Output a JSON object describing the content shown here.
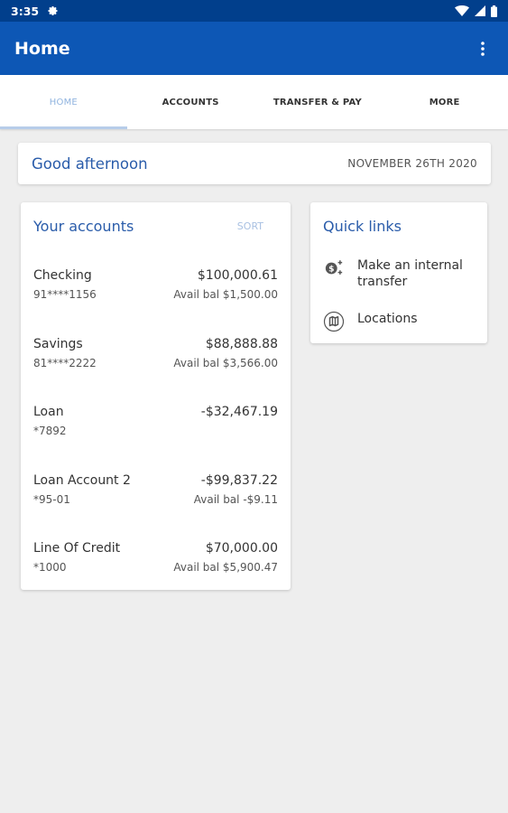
{
  "status_bar": {
    "time": "3:35"
  },
  "app_bar": {
    "title": "Home"
  },
  "tabs": [
    {
      "label": "HOME",
      "active": true
    },
    {
      "label": "ACCOUNTS",
      "active": false
    },
    {
      "label": "TRANSFER & PAY",
      "active": false
    },
    {
      "label": "MORE",
      "active": false
    }
  ],
  "greeting": {
    "text": "Good afternoon",
    "date": "NOVEMBER 26TH 2020"
  },
  "accounts": {
    "title": "Your accounts",
    "sort_label": "SORT",
    "items": [
      {
        "name": "Checking",
        "number": "91****1156",
        "balance": "$100,000.61",
        "available": "Avail bal $1,500.00"
      },
      {
        "name": "Savings",
        "number": "81****2222",
        "balance": "$88,888.88",
        "available": "Avail bal $3,566.00"
      },
      {
        "name": "Loan",
        "number": "*7892",
        "balance": "-$32,467.19",
        "available": ""
      },
      {
        "name": "Loan Account 2",
        "number": "*95-01",
        "balance": "-$99,837.22",
        "available": "Avail bal -$9.11"
      },
      {
        "name": "Line Of Credit",
        "number": "*1000",
        "balance": "$70,000.00",
        "available": "Avail bal $5,900.47"
      }
    ]
  },
  "quick_links": {
    "title": "Quick links",
    "items": [
      {
        "label": "Make an internal transfer",
        "icon": "transfer-money-icon"
      },
      {
        "label": "Locations",
        "icon": "map-icon"
      }
    ]
  },
  "colors": {
    "status_bar": "#013f8c",
    "app_bar": "#0d57b5",
    "accent_text": "#2a5caa",
    "active_tab": "#8fb3df"
  }
}
